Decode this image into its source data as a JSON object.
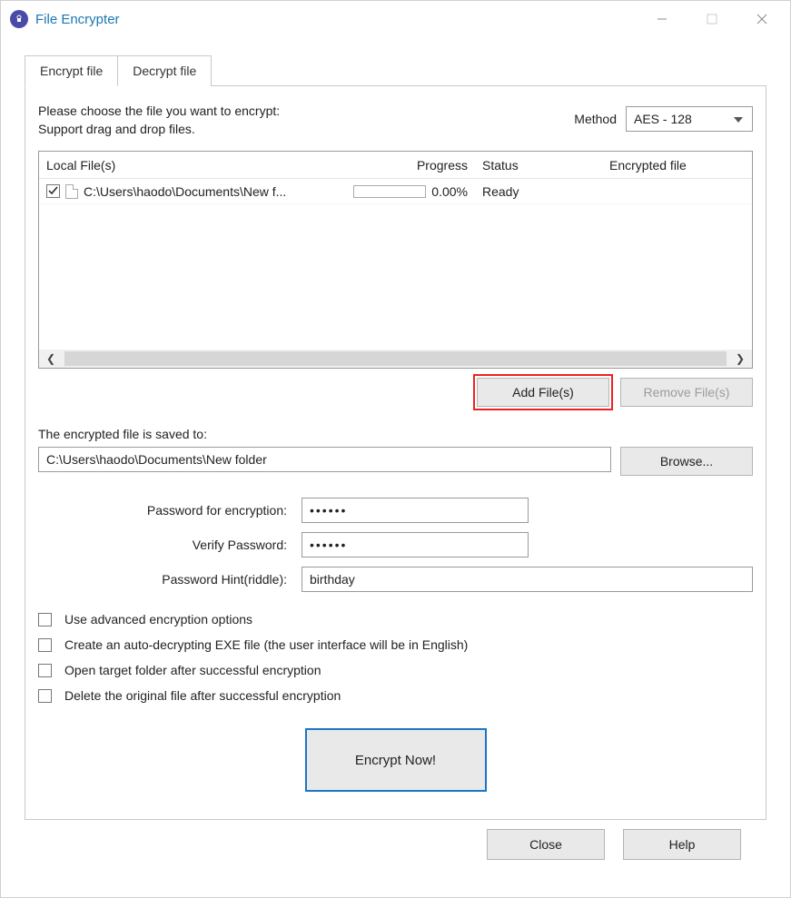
{
  "window": {
    "title": "File Encrypter"
  },
  "tabs": {
    "encrypt": "Encrypt file",
    "decrypt": "Decrypt file"
  },
  "instruction": {
    "line1": "Please choose the file you want to encrypt:",
    "line2": "Support drag and drop files."
  },
  "method": {
    "label": "Method",
    "value": "AES - 128"
  },
  "table": {
    "headers": {
      "file": "Local File(s)",
      "progress": "Progress",
      "status": "Status",
      "encfile": "Encrypted file"
    },
    "rows": [
      {
        "checked": true,
        "file": "C:\\Users\\haodo\\Documents\\New f...",
        "progress_pct": "0.00%",
        "status": "Ready",
        "encfile": ""
      }
    ]
  },
  "buttons": {
    "add": "Add File(s)",
    "remove": "Remove File(s)",
    "browse": "Browse...",
    "encrypt": "Encrypt Now!",
    "close": "Close",
    "help": "Help"
  },
  "save": {
    "label": "The encrypted file is saved to:",
    "path": "C:\\Users\\haodo\\Documents\\New folder"
  },
  "form": {
    "pw_label": "Password for encryption:",
    "pw_value": "••••••",
    "verify_label": "Verify Password:",
    "verify_value": "••••••",
    "hint_label": "Password Hint(riddle):",
    "hint_value": "birthday"
  },
  "options": {
    "advanced": "Use advanced encryption options",
    "exe": "Create an auto-decrypting EXE file (the user interface will be in English)",
    "open": "Open target folder after successful encryption",
    "delete": "Delete the original file after successful encryption"
  }
}
